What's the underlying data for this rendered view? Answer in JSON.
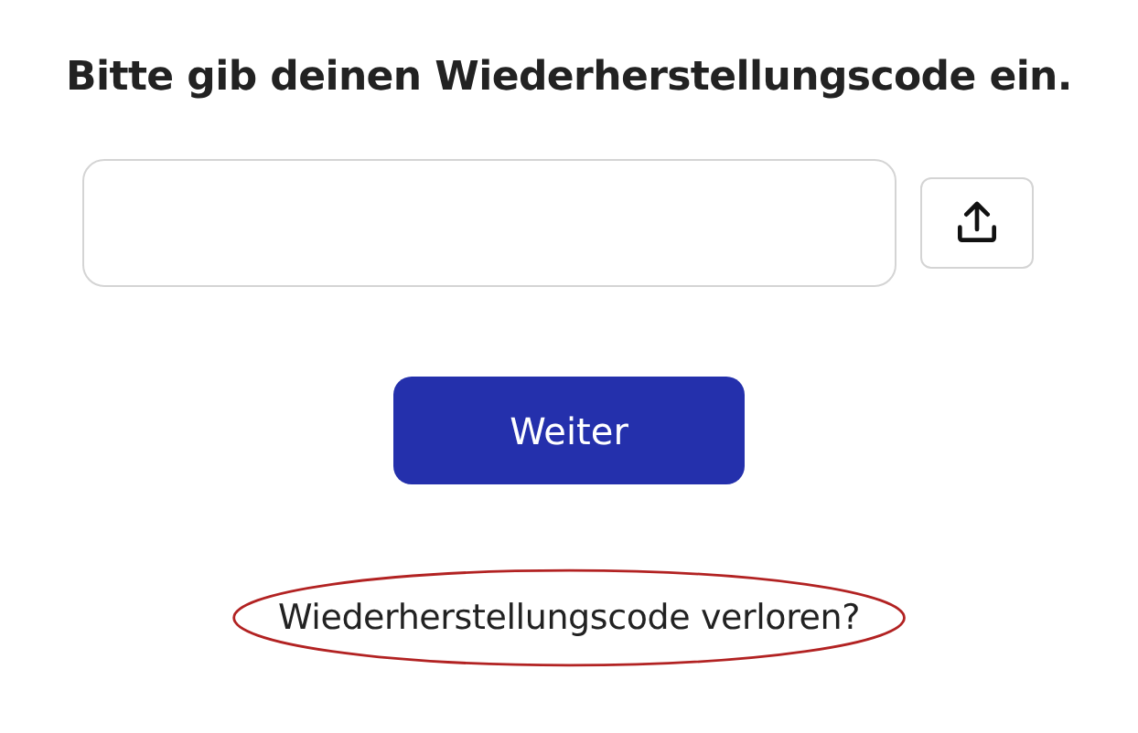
{
  "heading": "Bitte gib deinen Wiederherstellungscode ein.",
  "submit_button": {
    "label": "Weiter"
  },
  "lost_code_link": {
    "label": "Wiederherstellungscode verloren?",
    "circled": true
  }
}
